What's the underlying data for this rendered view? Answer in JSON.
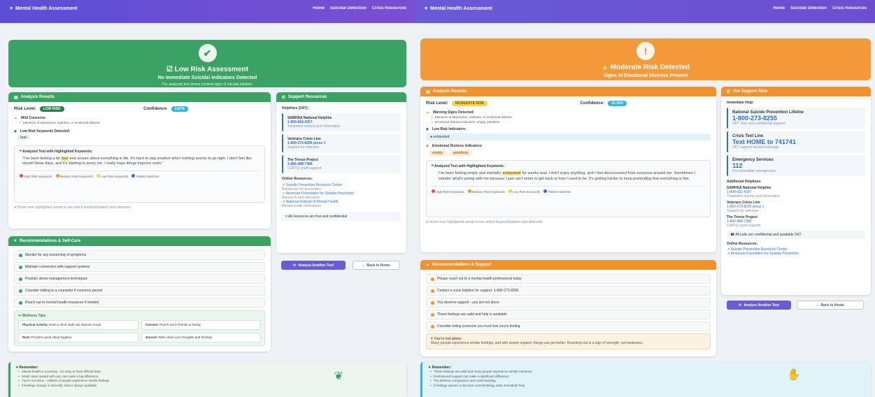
{
  "left": {
    "navbar": {
      "brand": "Mental Health Assessment",
      "links": [
        "Home",
        "Suicidal Detection",
        "Crisis Resources"
      ]
    },
    "hero": {
      "title": "Low Risk Assessment",
      "subtitle": "No Immediate Suicidal Indicators Detected",
      "note": "The analyzed text shows minimal signs of suicidal ideation."
    },
    "analysis": {
      "header": "Analysis Results",
      "risk_label": "Risk Level:",
      "risk_value": "LOW RISK",
      "confidence_label": "Confidence:",
      "confidence_value": "6.67%",
      "concern_title": "Mild Concerns:",
      "concern_item": "Mentions of depression, sadness, or emotional distress",
      "keywords_title": "Low Risk Keywords Detected:",
      "keyword": "lost",
      "highlight_title": "Analyzed Text with Highlighted Keywords:",
      "text_before": "\"I've been feeling a bit ",
      "text_hl": "lost",
      "text_after": " and unsure about everything in life. It's hard to stay positive when nothing seems to go right. I don't feel like myself these days, and it's starting to worry me. I really hope things improve soon.\"",
      "legend": [
        "High Risk Keywords",
        "Medium Risk Keywords",
        "Low Risk Keywords",
        "Pattern Matches"
      ],
      "hint": "Hover over highlighted words to see which keyword/pattern was detected"
    },
    "support": {
      "header": "Support Resources",
      "helplines_title": "Helplines (24/7):",
      "items": [
        {
          "name": "SAMHSA National Helpline",
          "phone": "1-800-662-4357",
          "desc": "Treatment referral and information"
        },
        {
          "name": "Veterans Crisis Line",
          "phone": "1-800-273-8255 press 1",
          "desc": "Support for veterans"
        },
        {
          "name": "The Trevor Project",
          "phone": "1-866-488-7386",
          "desc": "LGBTQ youth support"
        }
      ],
      "online_title": "Online Resources:",
      "online": [
        {
          "name": "Suicide Prevention Resource Center",
          "desc": "Resources for prevention"
        },
        {
          "name": "American Foundation for Suicide Prevention",
          "desc": "Research and education"
        },
        {
          "name": "National Institute of Mental Health",
          "desc": "Mental health information"
        }
      ],
      "footer": "All resources are free and confidential"
    },
    "buttons": {
      "analyze": "Analyze Another Text",
      "home": "Back to Home"
    },
    "recommendations": {
      "header": "Recommendations & Self-Care",
      "items": [
        "Monitor for any worsening of symptoms",
        "Maintain connection with support systems",
        "Practice stress management techniques",
        "Consider talking to a counselor if concerns persist",
        "Reach out to mental health resources if needed"
      ],
      "tips_title": "Wellness Tips:",
      "tips": [
        {
          "k": "Physical Activity:",
          "v": "Even a short walk can improve mood"
        },
        {
          "k": "Connect:",
          "v": "Reach out to friends or family"
        },
        {
          "k": "Rest:",
          "v": "Prioritize good sleep hygiene"
        },
        {
          "k": "Journal:",
          "v": "Write down your thoughts and feelings"
        }
      ]
    },
    "remember": {
      "title": "Remember:",
      "items": [
        "Mental health is a journey - it's okay to have difficult days",
        "Small steps toward self-care can make a big difference",
        "You're not alone - millions of people experience similar feelings",
        "If feelings change or intensify, help is always available"
      ]
    }
  },
  "right": {
    "navbar": {
      "brand": "Mental Health Assessment",
      "links": [
        "Home",
        "Suicidal Detection",
        "Crisis Resources"
      ]
    },
    "hero": {
      "title": "Moderate Risk Detected",
      "subtitle": "Signs of Emotional Distress Present"
    },
    "analysis": {
      "header": "Analysis Results",
      "risk_label": "Risk Level:",
      "risk_value": "MODERATE RISK",
      "confidence_label": "Confidence:",
      "confidence_value": "33.33%",
      "warning_title": "Warning Signs Detected:",
      "warning_items": [
        "Mentions of depression, sadness, or emotional distress",
        "Emotional distress indicators: empty, pointless"
      ],
      "low_title": "Low Risk Indicators:",
      "low_value": "exhausted",
      "emotion_title": "Emotional Distress Indicators:",
      "emotion_tags": [
        "empty",
        "pointless"
      ],
      "highlight_title": "Analyzed Text with Highlighted Keywords:",
      "text_before": "I've been feeling empty and mentally ",
      "text_hl": "exhausted",
      "text_after": " for weeks now. I don't enjoy anything, and I feel disconnected from everyone around me. Sometimes I wonder what's wrong with me because I just can't seem to get back to how I used to be. It's getting harder to keep pretending that everything is fine.",
      "legend": [
        "High Risk Keywords",
        "Medium Risk Keywords",
        "Low Risk Keywords",
        "Pattern Matches"
      ],
      "hint": "Hover over highlighted words to see which keyword/pattern was detected"
    },
    "support": {
      "header": "Get Support Now",
      "immediate_title": "Immediate Help:",
      "big": [
        {
          "name": "National Suicide Prevention Lifeline",
          "phone": "1-800-273-8255",
          "desc": "24/7, free and confidential support"
        },
        {
          "name": "Crisis Text Line",
          "phone": "Text HOME to 741741",
          "desc": "24/7 support via text message"
        },
        {
          "name": "Emergency Services",
          "phone": "112",
          "desc": "For immediate emergencies"
        }
      ],
      "additional_title": "Additional Helplines:",
      "additional": [
        {
          "name": "SAMHSA National Helpline",
          "phone": "1-800-662-4357",
          "desc": "Treatment referral and information"
        },
        {
          "name": "Veterans Crisis Line",
          "phone": "1-800-273-8255 press 1",
          "desc": "Support for veterans"
        },
        {
          "name": "The Trevor Project",
          "phone": "1-866-488-7386",
          "desc": "LGBTQ youth support"
        }
      ],
      "note": "All calls are confidential and available 24/7",
      "online_title": "Online Resources:",
      "online": [
        "Suicide Prevention Resource Center",
        "American Foundation for Suicide Prevention"
      ]
    },
    "buttons": {
      "analyze": "Analyze Another Text",
      "home": "Back to Home"
    },
    "recommendations": {
      "header": "Recommendations & Support",
      "items": [
        "Please reach out to a mental health professional today",
        "Contact a crisis helpline for support: 1-800-273-8255",
        "You deserve support - you are not alone",
        "These feelings are valid and help is available",
        "Consider telling someone you trust how you're feeling"
      ],
      "alone_title": "You're not alone:",
      "alone_text": "Many people experience similar feelings, and with proper support, things can get better. Reaching out is a sign of strength, not weakness."
    },
    "remember": {
      "title": "Remember:",
      "items": [
        "These feelings are valid and many people experience similar emotions",
        "Professional support can make a significant difference",
        "You deserve compassion and understanding",
        "If feelings worsen or become overwhelming, seek immediate help"
      ]
    }
  },
  "colors": {
    "nav": "#6a4fd4",
    "green": "#3aa363",
    "orange": "#f0922e",
    "blue_link": "#2c6fd1"
  }
}
